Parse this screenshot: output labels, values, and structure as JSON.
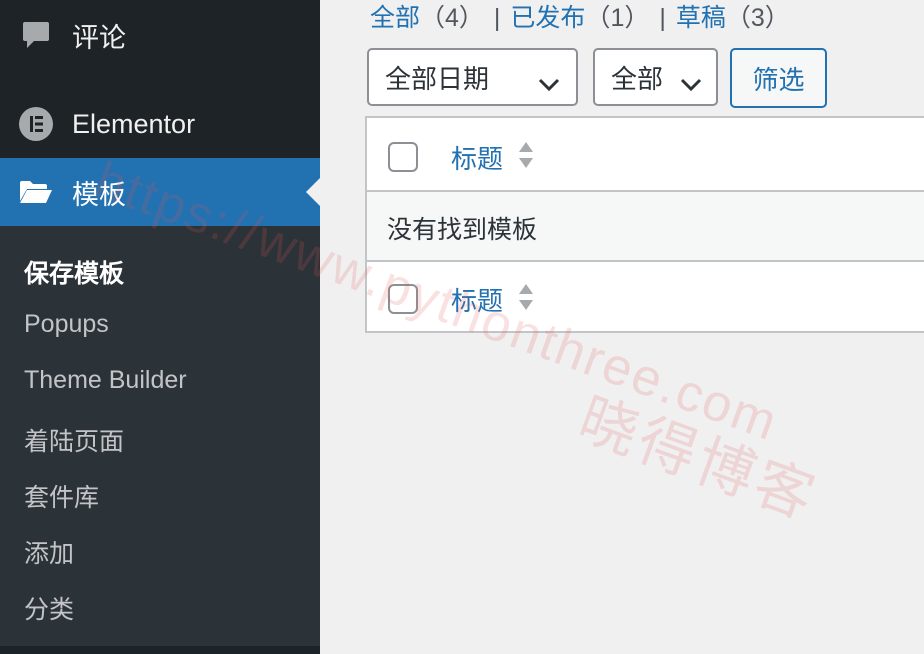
{
  "sidebar": {
    "comments": {
      "label": "评论",
      "icon": "comment-bubble-icon"
    },
    "elementor": {
      "label": "Elementor",
      "icon": "elementor-logo-icon"
    },
    "templates": {
      "label": "模板",
      "icon": "folder-open-icon",
      "active": true
    },
    "submenu": [
      {
        "label": "保存模板",
        "current": true
      },
      {
        "label": "Popups"
      },
      {
        "label": "Theme Builder"
      },
      {
        "label": "着陆页面"
      },
      {
        "label": "套件库"
      },
      {
        "label": "添加"
      },
      {
        "label": "分类"
      }
    ],
    "colors": {
      "bg": "#1d2327",
      "submenu_bg": "#2c3338",
      "active_bg": "#2271b1"
    }
  },
  "status_links": [
    {
      "label": "全部",
      "count": "（4）"
    },
    {
      "label": "已发布",
      "count": "（1）"
    },
    {
      "label": "草稿",
      "count": "（3）"
    }
  ],
  "filters": {
    "date_select": "全部日期",
    "type_select": "全部",
    "filter_button": "筛选"
  },
  "table": {
    "header_title": "标题",
    "empty_message": "没有找到模板",
    "footer_title": "标题"
  },
  "watermark": {
    "url": "https://www.pythonthree.com",
    "text": "晓得博客"
  },
  "accent_color": "#2271b1"
}
